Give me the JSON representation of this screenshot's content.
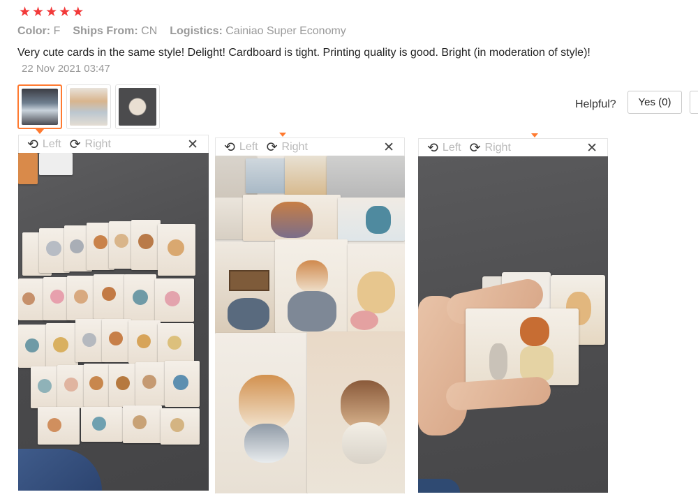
{
  "review": {
    "rating": 5,
    "stars": [
      "★",
      "★",
      "★",
      "★",
      "★"
    ],
    "color_label": "Color:",
    "color_value": "F",
    "ships_label": "Ships From:",
    "ships_value": "CN",
    "logistics_label": "Logistics:",
    "logistics_value": "Cainiao Super Economy",
    "text": "Very cute cards in the same style! Delight! Cardboard is tight. Printing quality is good. Bright (in moderation of style)!",
    "date": "22 Nov 2021 03:47"
  },
  "helpful": {
    "label": "Helpful?",
    "yes_label": "Yes (0)"
  },
  "viewer_toolbar": {
    "left_label": "Left",
    "right_label": "Right",
    "rotate_left_icon": "rotate-left-icon",
    "rotate_right_icon": "rotate-right-icon",
    "close_icon": "close-icon",
    "rotate_left_glyph": "⟲",
    "rotate_right_glyph": "⟳",
    "close_glyph": "✕"
  },
  "colors": {
    "star": "#f23a3a",
    "accent": "#ff7a30",
    "muted_text": "#999999"
  }
}
